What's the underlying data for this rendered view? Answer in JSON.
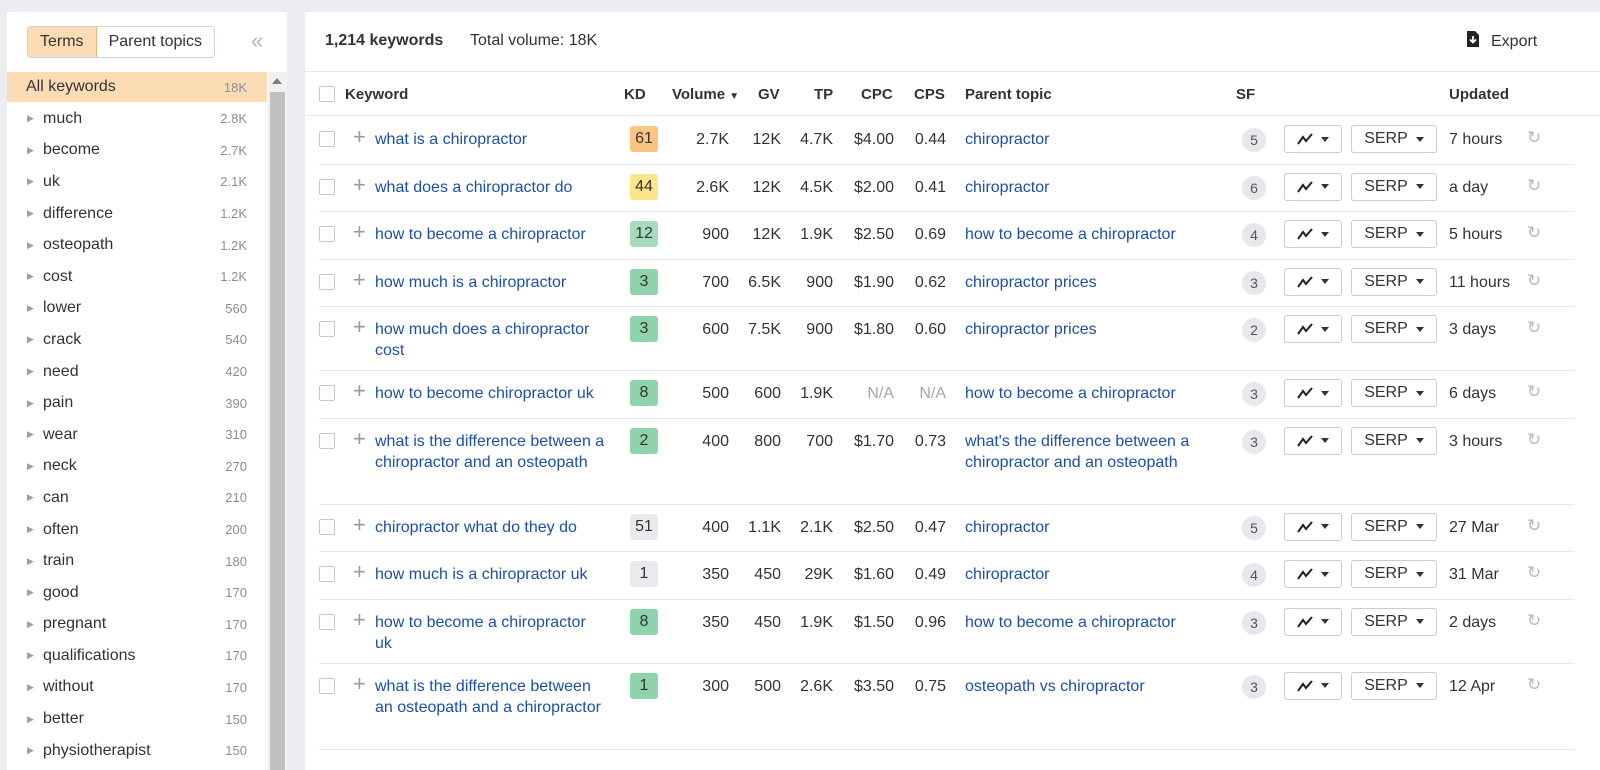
{
  "sidebar": {
    "tabs": [
      "Terms",
      "Parent topics"
    ],
    "collapse_icon": "double-chevron-left-icon",
    "items": [
      {
        "label": "All keywords",
        "count": "18K"
      },
      {
        "label": "much",
        "count": "2.8K"
      },
      {
        "label": "become",
        "count": "2.7K"
      },
      {
        "label": "uk",
        "count": "2.1K"
      },
      {
        "label": "difference",
        "count": "1.2K"
      },
      {
        "label": "osteopath",
        "count": "1.2K"
      },
      {
        "label": "cost",
        "count": "1.2K"
      },
      {
        "label": "lower",
        "count": "560"
      },
      {
        "label": "crack",
        "count": "540"
      },
      {
        "label": "need",
        "count": "420"
      },
      {
        "label": "pain",
        "count": "390"
      },
      {
        "label": "wear",
        "count": "310"
      },
      {
        "label": "neck",
        "count": "270"
      },
      {
        "label": "can",
        "count": "210"
      },
      {
        "label": "often",
        "count": "200"
      },
      {
        "label": "train",
        "count": "180"
      },
      {
        "label": "good",
        "count": "170"
      },
      {
        "label": "pregnant",
        "count": "170"
      },
      {
        "label": "qualifications",
        "count": "170"
      },
      {
        "label": "without",
        "count": "170"
      },
      {
        "label": "better",
        "count": "150"
      },
      {
        "label": "physiotherapist",
        "count": "150"
      }
    ]
  },
  "header": {
    "keyword_count": "1,214 keywords",
    "total_volume": "Total volume: 18K",
    "export_label": "Export"
  },
  "columns": {
    "keyword": "Keyword",
    "kd": "KD",
    "volume": "Volume",
    "gv": "GV",
    "tp": "TP",
    "cpc": "CPC",
    "cps": "CPS",
    "parent_topic": "Parent topic",
    "sf": "SF",
    "updated": "Updated"
  },
  "colors": {
    "kd_orange": "#fbc581",
    "kd_yellow": "#fde68a",
    "kd_green": "#8fd3ad",
    "kd_gray": "#e8eaed",
    "link": "#1d4ea8",
    "highlight": "#fcdcb4"
  },
  "rows": [
    {
      "keyword": "what is a chiropractor",
      "kd": "61",
      "kd_color": "#fbc581",
      "volume": "2.7K",
      "gv": "12K",
      "tp": "4.7K",
      "cpc": "$4.00",
      "cps": "0.44",
      "parent_topic": "chiropractor",
      "sf": "5",
      "serp": "SERP",
      "updated": "7 hours"
    },
    {
      "keyword": "what does a chiropractor do",
      "kd": "44",
      "kd_color": "#fde68a",
      "volume": "2.6K",
      "gv": "12K",
      "tp": "4.5K",
      "cpc": "$2.00",
      "cps": "0.41",
      "parent_topic": "chiropractor",
      "sf": "6",
      "serp": "SERP",
      "updated": "a day"
    },
    {
      "keyword": "how to become a chiropractor",
      "kd": "12",
      "kd_color": "#a6dcbb",
      "volume": "900",
      "gv": "12K",
      "tp": "1.9K",
      "cpc": "$2.50",
      "cps": "0.69",
      "parent_topic": "how to become a chiropractor",
      "sf": "4",
      "serp": "SERP",
      "updated": "5 hours"
    },
    {
      "keyword": "how much is a chiropractor",
      "kd": "3",
      "kd_color": "#8fd3ad",
      "volume": "700",
      "gv": "6.5K",
      "tp": "900",
      "cpc": "$1.90",
      "cps": "0.62",
      "parent_topic": "chiropractor prices",
      "sf": "3",
      "serp": "SERP",
      "updated": "11 hours"
    },
    {
      "keyword": "how much does a chiropractor cost",
      "kd": "3",
      "kd_color": "#8fd3ad",
      "volume": "600",
      "gv": "7.5K",
      "tp": "900",
      "cpc": "$1.80",
      "cps": "0.60",
      "parent_topic": "chiropractor prices",
      "sf": "2",
      "serp": "SERP",
      "updated": "3 days"
    },
    {
      "keyword": "how to become chiropractor uk",
      "kd": "8",
      "kd_color": "#8fd3ad",
      "volume": "500",
      "gv": "600",
      "tp": "1.9K",
      "cpc": "N/A",
      "cps": "N/A",
      "parent_topic": "how to become a chiropractor",
      "sf": "3",
      "serp": "SERP",
      "updated": "6 days"
    },
    {
      "keyword": "what is the difference between a chiropractor and an osteopath",
      "kd": "2",
      "kd_color": "#8fd3ad",
      "volume": "400",
      "gv": "800",
      "tp": "700",
      "cpc": "$1.70",
      "cps": "0.73",
      "parent_topic": "what's the difference between a chiropractor and an osteopath",
      "sf": "3",
      "serp": "SERP",
      "updated": "3 hours"
    },
    {
      "keyword": "chiropractor what do they do",
      "kd": "51",
      "kd_color": "#e8eaed",
      "volume": "400",
      "gv": "1.1K",
      "tp": "2.1K",
      "cpc": "$2.50",
      "cps": "0.47",
      "parent_topic": "chiropractor",
      "sf": "5",
      "serp": "SERP",
      "updated": "27 Mar"
    },
    {
      "keyword": "how much is a chiropractor uk",
      "kd": "1",
      "kd_color": "#e8eaed",
      "volume": "350",
      "gv": "450",
      "tp": "29K",
      "cpc": "$1.60",
      "cps": "0.49",
      "parent_topic": "chiropractor",
      "sf": "4",
      "serp": "SERP",
      "updated": "31 Mar"
    },
    {
      "keyword": "how to become a chiropractor uk",
      "kd": "8",
      "kd_color": "#8fd3ad",
      "volume": "350",
      "gv": "450",
      "tp": "1.9K",
      "cpc": "$1.50",
      "cps": "0.96",
      "parent_topic": "how to become a chiropractor",
      "sf": "3",
      "serp": "SERP",
      "updated": "2 days"
    },
    {
      "keyword": "what is the difference between an osteopath and a chiropractor",
      "kd": "1",
      "kd_color": "#8fd3ad",
      "volume": "300",
      "gv": "500",
      "tp": "2.6K",
      "cpc": "$3.50",
      "cps": "0.75",
      "parent_topic": "osteopath vs chiropractor",
      "sf": "3",
      "serp": "SERP",
      "updated": "12 Apr"
    }
  ]
}
